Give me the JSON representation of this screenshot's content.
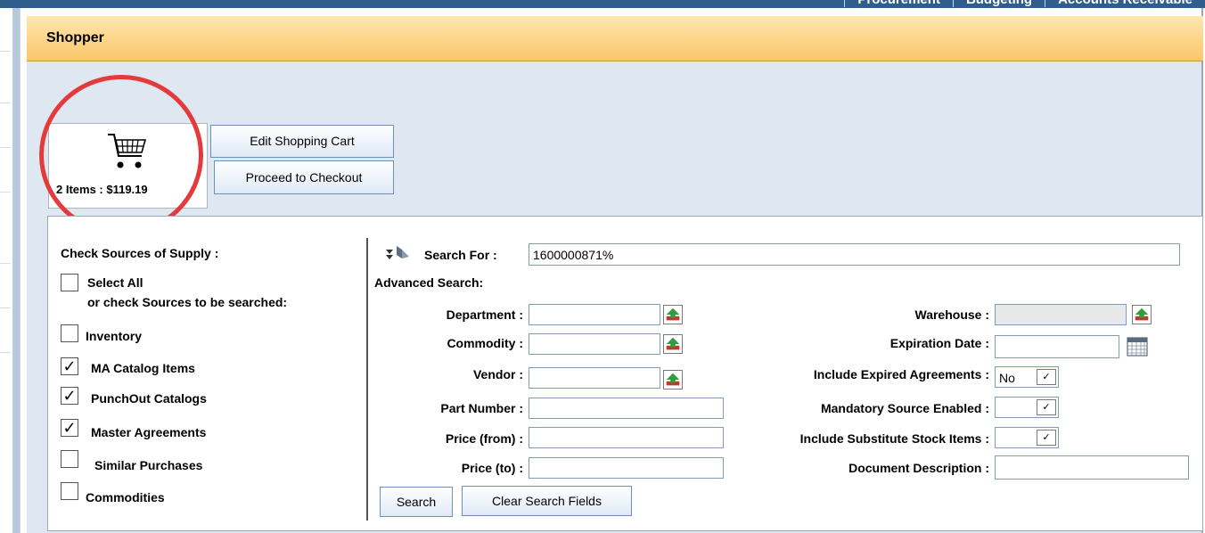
{
  "topnav": [
    "Procurement",
    "Budgeting",
    "Accounts Receivable"
  ],
  "header": {
    "title": "Shopper"
  },
  "cart": {
    "summary": "2 Items :  $119.19",
    "edit_label": "Edit Shopping Cart",
    "checkout_label": "Proceed to Checkout"
  },
  "sources": {
    "heading": "Check Sources of Supply :",
    "select_all": "Select All",
    "select_hint": "or check Sources to be searched:",
    "items": [
      {
        "label": "Inventory",
        "checked": false
      },
      {
        "label": "MA Catalog Items",
        "checked": true
      },
      {
        "label": "PunchOut Catalogs",
        "checked": true
      },
      {
        "label": "Master Agreements",
        "checked": true
      },
      {
        "label": "Similar Purchases",
        "checked": false
      },
      {
        "label": "Commodities",
        "checked": false
      }
    ],
    "check_glyph": "✓"
  },
  "search": {
    "search_for_label": "Search For :",
    "search_for_value": "1600000871%",
    "advanced_label": "Advanced Search:",
    "department_label": "Department :",
    "commodity_label": "Commodity :",
    "vendor_label": "Vendor :",
    "part_number_label": "Part Number :",
    "price_from_label": "Price (from) :",
    "price_to_label": "Price (to) :",
    "warehouse_label": "Warehouse :",
    "expiration_label": "Expiration Date :",
    "include_expired_label": "Include Expired Agreements :",
    "include_expired_value": "No",
    "mandatory_label": "Mandatory Source Enabled :",
    "mandatory_value": "",
    "substitute_label": "Include Substitute Stock Items :",
    "substitute_value": "",
    "doc_desc_label": "Document Description :",
    "search_button": "Search",
    "clear_button": "Clear Search Fields"
  },
  "colors": {
    "header_gradient_top": "#ffe6b0",
    "header_gradient_bottom": "#fbc667",
    "content_bg": "#dfe7f1",
    "highlight_ring": "#e33b3b"
  }
}
